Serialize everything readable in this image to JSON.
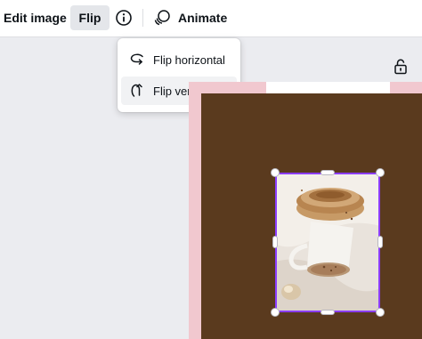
{
  "toolbar": {
    "edit_image_label": "Edit image",
    "flip_label": "Flip",
    "animate_label": "Animate"
  },
  "flip_menu": {
    "items": [
      {
        "label": "Flip horizontal",
        "icon": "flip-horizontal-icon"
      },
      {
        "label": "Flip vertical",
        "icon": "flip-vertical-icon"
      }
    ]
  },
  "colors": {
    "accent": "#8b3dff",
    "canvas_background": "#5a3a1e",
    "canvas_border": "#f1c8cf"
  }
}
